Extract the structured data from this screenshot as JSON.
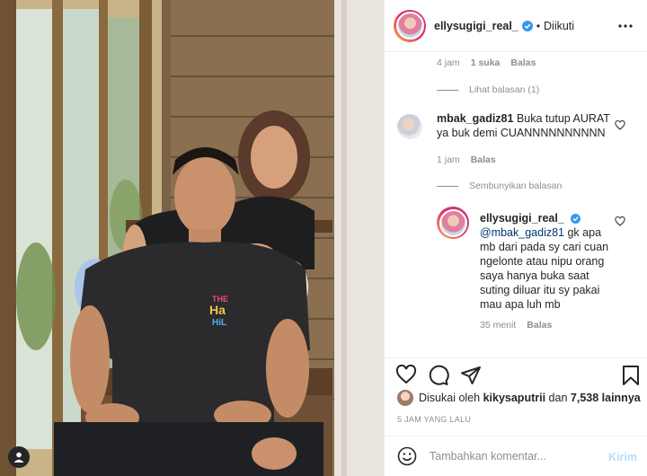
{
  "post": {
    "author": "ellysugigi_real_",
    "follow_status": "Diikuti",
    "bullet": "•",
    "more_icon": "more-horizontal-icon"
  },
  "top_reply_meta": {
    "time": "4 jam",
    "likes": "1 suka",
    "reply": "Balas"
  },
  "view_replies": "Lihat balasan (1)",
  "comment": {
    "user": "mbak_gadiz81",
    "text": "Buka tutup AURAT ya buk demi CUANNNNNNNNNN",
    "time": "1 jam",
    "reply": "Balas"
  },
  "hide_replies": "Sembunyikan balasan",
  "reply": {
    "user": "ellysugigi_real_",
    "mention": "@mbak_gadiz81",
    "text": "gk apa mb dari pada sy cari cuan ngelonte atau nipu orang saya hanya buka saat suting diluar itu sy pakai mau apa luh mb",
    "time": "35 menit",
    "reply": "Balas"
  },
  "likes": {
    "prefix": "Disukai oleh",
    "user": "kikysaputrii",
    "middle": "dan",
    "count": "7,538 lainnya"
  },
  "posted_time": "5 JAM YANG LALU",
  "composer": {
    "placeholder": "Tambahkan komentar...",
    "send": "Kirim"
  },
  "colors": {
    "link": "#00376b",
    "verified": "#3897f0",
    "send_disabled": "#b2dffc",
    "meta": "#8e8e8e"
  }
}
